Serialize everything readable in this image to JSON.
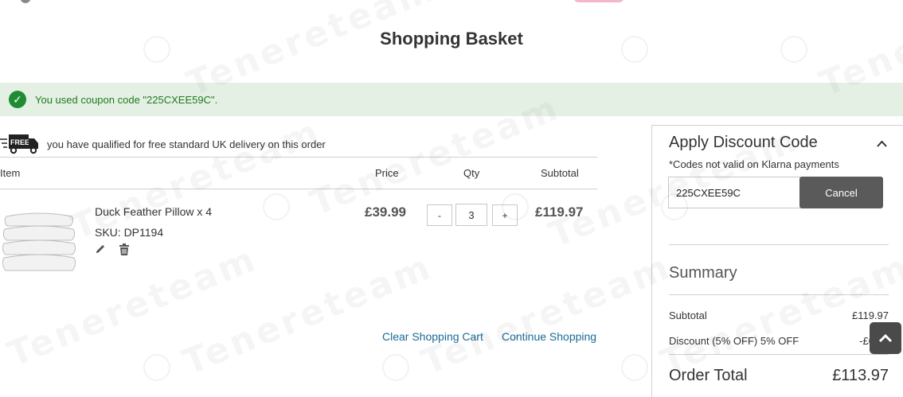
{
  "page": {
    "title": "Shopping Basket"
  },
  "message": {
    "coupon_applied": "You used coupon code \"225CXEE59C\"."
  },
  "delivery": {
    "badge": "FREE",
    "text": "you have qualified for free standard UK delivery on this order"
  },
  "cart": {
    "columns": {
      "item": "Item",
      "price": "Price",
      "qty": "Qty",
      "subtotal": "Subtotal"
    },
    "items": [
      {
        "name": "Duck Feather Pillow x 4",
        "sku": "SKU: DP1194",
        "price": "£39.99",
        "qty": "3",
        "subtotal": "£119.97",
        "minus_label": "-",
        "plus_label": "+"
      }
    ],
    "actions": {
      "clear": "Clear Shopping Cart",
      "continue": "Continue Shopping"
    }
  },
  "discount": {
    "title": "Apply Discount Code",
    "note": "*Codes not valid on Klarna payments",
    "code_value": "225CXEE59C",
    "cancel_label": "Cancel"
  },
  "summary": {
    "title": "Summary",
    "subtotal_label": "Subtotal",
    "subtotal_value": "£119.97",
    "discount_label": "Discount (5% OFF) 5% OFF",
    "discount_value": "-£6.00",
    "total_label": "Order Total",
    "total_value": "£113.97"
  },
  "watermark": "Tenereteam",
  "colors": {
    "success_bg": "#e5f0e5",
    "success_icon": "#1f8c34",
    "link": "#1a6a97",
    "button_dark": "#5a5a5a"
  }
}
